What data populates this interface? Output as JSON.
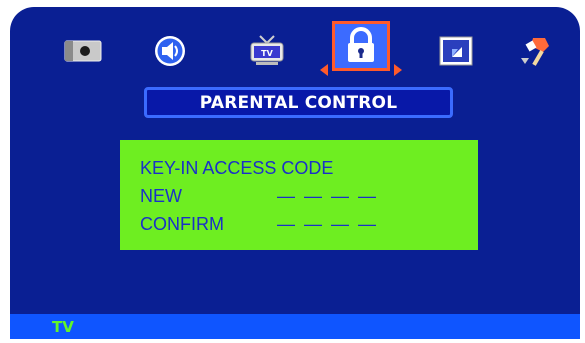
{
  "menu": {
    "items": [
      {
        "icon": "picture-icon"
      },
      {
        "icon": "audio-icon"
      },
      {
        "icon": "tv-icon"
      },
      {
        "icon": "lock-icon",
        "selected": true
      },
      {
        "icon": "screen-icon"
      },
      {
        "icon": "setup-icon"
      }
    ]
  },
  "page": {
    "title": "PARENTAL CONTROL"
  },
  "access_code": {
    "heading": "KEY-IN ACCESS CODE",
    "new_label": "NEW",
    "new_value": "— — — —",
    "confirm_label": "CONFIRM",
    "confirm_value": "— — — —"
  },
  "status": {
    "source": "TV"
  },
  "colors": {
    "background": "#0a1f93",
    "panel": "#6eee21",
    "panel_text": "#1a31c8",
    "highlight": "#ff5a2a",
    "status_bar": "#0f55ff",
    "status_text": "#62f52a"
  }
}
